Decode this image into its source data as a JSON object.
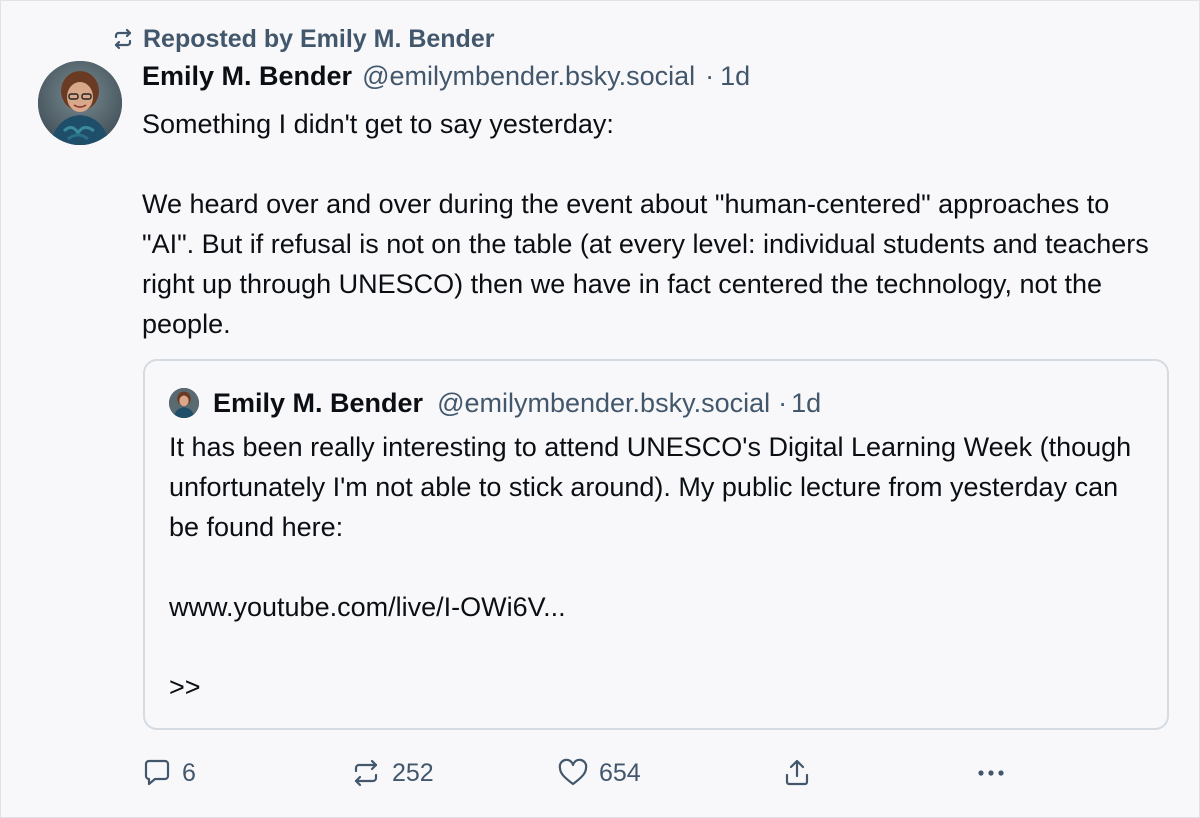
{
  "repost": {
    "label": "Reposted by Emily M. Bender",
    "icon": "repost-icon"
  },
  "post": {
    "author_name": "Emily M. Bender",
    "handle": "@emilymbender.bsky.social",
    "separator": "·",
    "time": "1d",
    "text": "Something I didn't get to say yesterday:\n\nWe heard over and over during the event about \"human-centered\" approaches to \"AI\". But if refusal is not on the table (at every level: individual students and teachers right up through UNESCO) then we have in fact centered the technology, not the people."
  },
  "quote": {
    "author_name": "Emily M. Bender",
    "handle": "@emilymbender.bsky.social",
    "separator": "·",
    "time": "1d",
    "text": "It has been really interesting to attend UNESCO's Digital Learning Week (though unfortunately I'm not able to stick around). My public lecture from yesterday can be found here:\n\nwww.youtube.com/live/I-OWi6V...\n\n>>"
  },
  "actions": {
    "reply_count": "6",
    "repost_count": "252",
    "like_count": "654",
    "icons": [
      "reply-icon",
      "repost-icon",
      "heart-icon",
      "share-icon",
      "more-icon"
    ]
  },
  "colors": {
    "background": "#f8f8fa",
    "text": "#0b0f14",
    "muted": "#42576c",
    "border": "#d4dbe2"
  }
}
